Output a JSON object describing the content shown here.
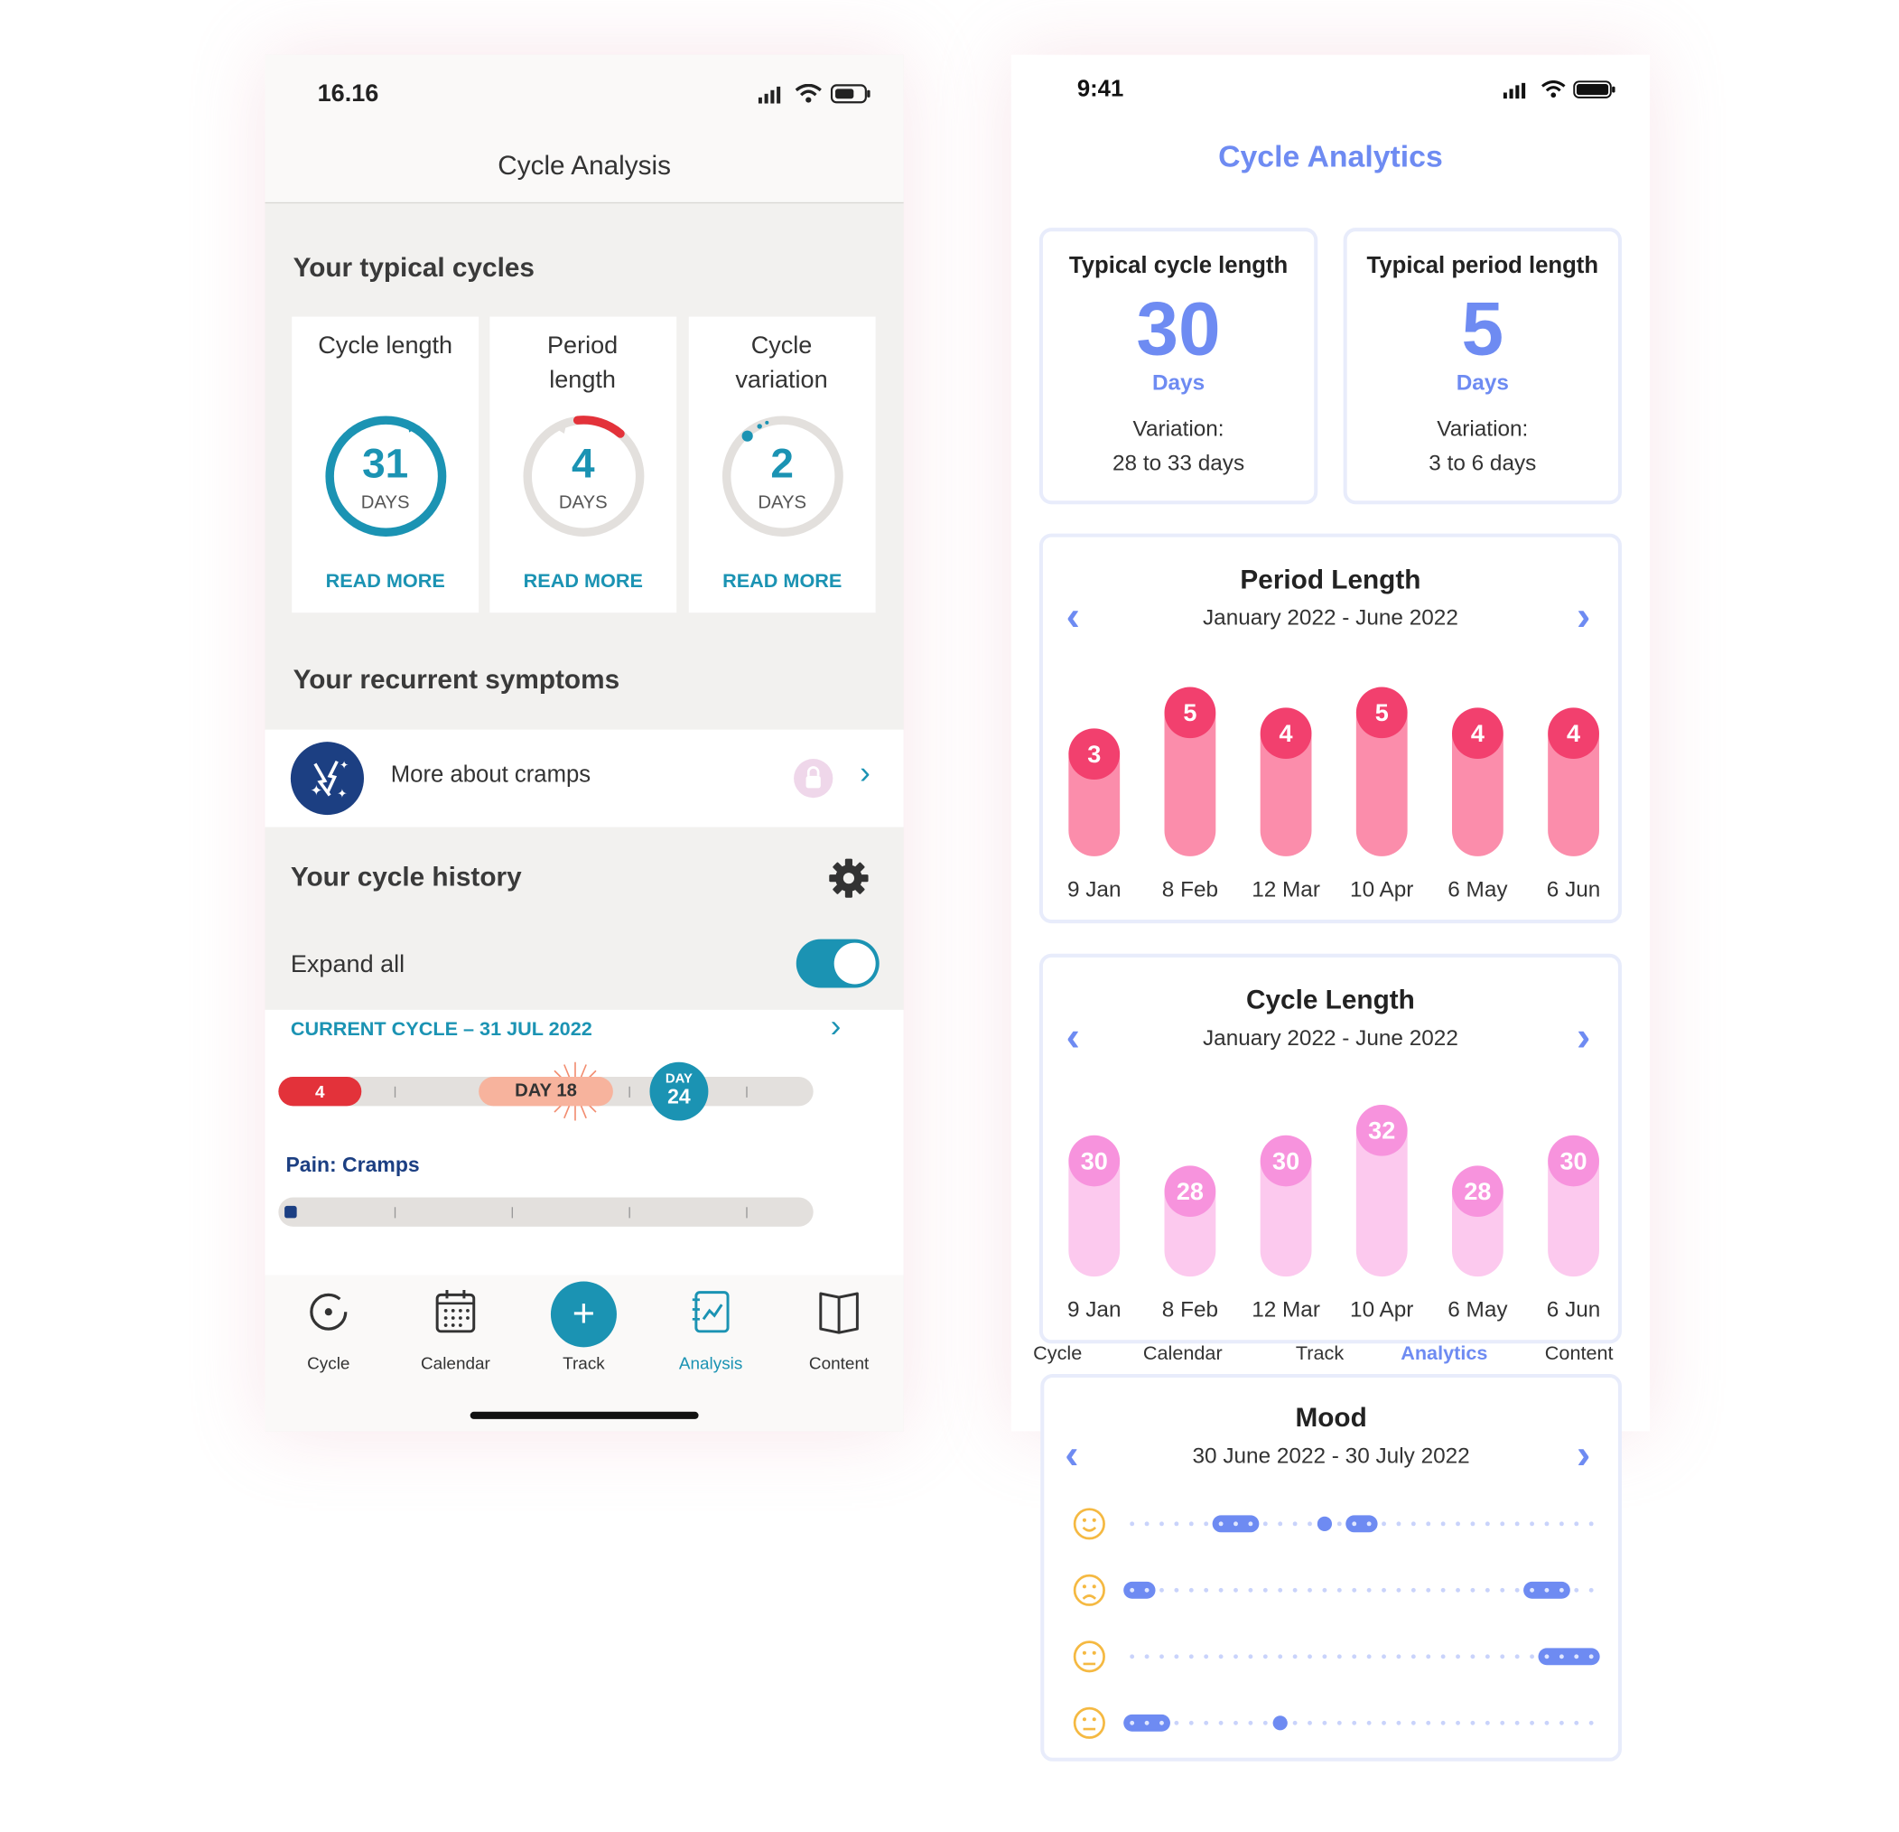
{
  "left": {
    "status_time": "16.16",
    "title": "Cycle Analysis",
    "typical_title": "Your typical cycles",
    "cards": [
      {
        "label": "Cycle length",
        "value": "31",
        "unit": "DAYS",
        "link": "READ MORE"
      },
      {
        "label": "Period length",
        "value": "4",
        "unit": "DAYS",
        "link": "READ MORE"
      },
      {
        "label": "Cycle variation",
        "value": "2",
        "unit": "DAYS",
        "link": "READ MORE"
      }
    ],
    "symptoms_title": "Your recurrent symptoms",
    "symptom_item": "More about cramps",
    "history_title": "Your cycle history",
    "expand_label": "Expand all",
    "expand_on": true,
    "current_cycle": "CURRENT CYCLE – 31 JUL 2022",
    "period_pill": "4",
    "day18_pill": "DAY 18",
    "day24_top": "DAY",
    "day24_num": "24",
    "pain_label": "Pain: Cramps",
    "tabs": [
      "Cycle",
      "Calendar",
      "Track",
      "Analysis",
      "Content"
    ],
    "active_tab": "Analysis",
    "colors": {
      "accent": "#1b93b3",
      "period": "#e3323a",
      "ovulation": "#f7b39d",
      "navy": "#1c3f82"
    }
  },
  "right": {
    "status_time": "9:41",
    "title": "Cycle Analytics",
    "card_cycle": {
      "heading": "Typical cycle length",
      "value": "30",
      "unit": "Days",
      "var_label": "Variation:",
      "var_value": "28 to 33 days"
    },
    "card_period": {
      "heading": "Typical period length",
      "value": "5",
      "unit": "Days",
      "var_label": "Variation:",
      "var_value": "3 to 6 days"
    },
    "period_chart": {
      "title": "Period Length",
      "range": "January 2022 - June 2022"
    },
    "cycle_chart": {
      "title": "Cycle Length",
      "range": "January 2022 - June 2022"
    },
    "mood_chart": {
      "title": "Mood",
      "range": "30 June 2022 - 30 July 2022"
    },
    "tabs": [
      "Cycle",
      "Calendar",
      "Track",
      "Analytics",
      "Content"
    ],
    "active_tab": "Analytics",
    "colors": {
      "accent": "#6e8bf2",
      "period_bar": "#fb8dab",
      "period_dot": "#f2406e",
      "cycle_bar": "#fcc9ee",
      "cycle_dot": "#f793dd",
      "mood_face": "#f5b942"
    }
  },
  "chart_data": [
    {
      "type": "bar",
      "title": "Period Length",
      "categories": [
        "9 Jan",
        "8 Feb",
        "12 Mar",
        "10 Apr",
        "6 May",
        "6 Jun"
      ],
      "values": [
        3,
        5,
        4,
        5,
        4,
        4
      ]
    },
    {
      "type": "bar",
      "title": "Cycle Length",
      "categories": [
        "9 Jan",
        "8 Feb",
        "12 Mar",
        "10 Apr",
        "6 May",
        "6 Jun"
      ],
      "values": [
        30,
        28,
        30,
        32,
        28,
        30
      ]
    },
    {
      "type": "scatter",
      "title": "Mood",
      "rows": [
        {
          "icon": "happy-face-icon",
          "days": [
            6,
            7,
            8,
            13,
            15,
            16
          ]
        },
        {
          "icon": "sad-face-icon",
          "days": [
            0,
            1,
            27,
            28,
            29
          ]
        },
        {
          "icon": "angry-face-icon",
          "days": [
            28,
            29,
            30,
            31
          ]
        },
        {
          "icon": "neutral-face-icon",
          "days": [
            0,
            1,
            2,
            10
          ]
        }
      ]
    }
  ]
}
